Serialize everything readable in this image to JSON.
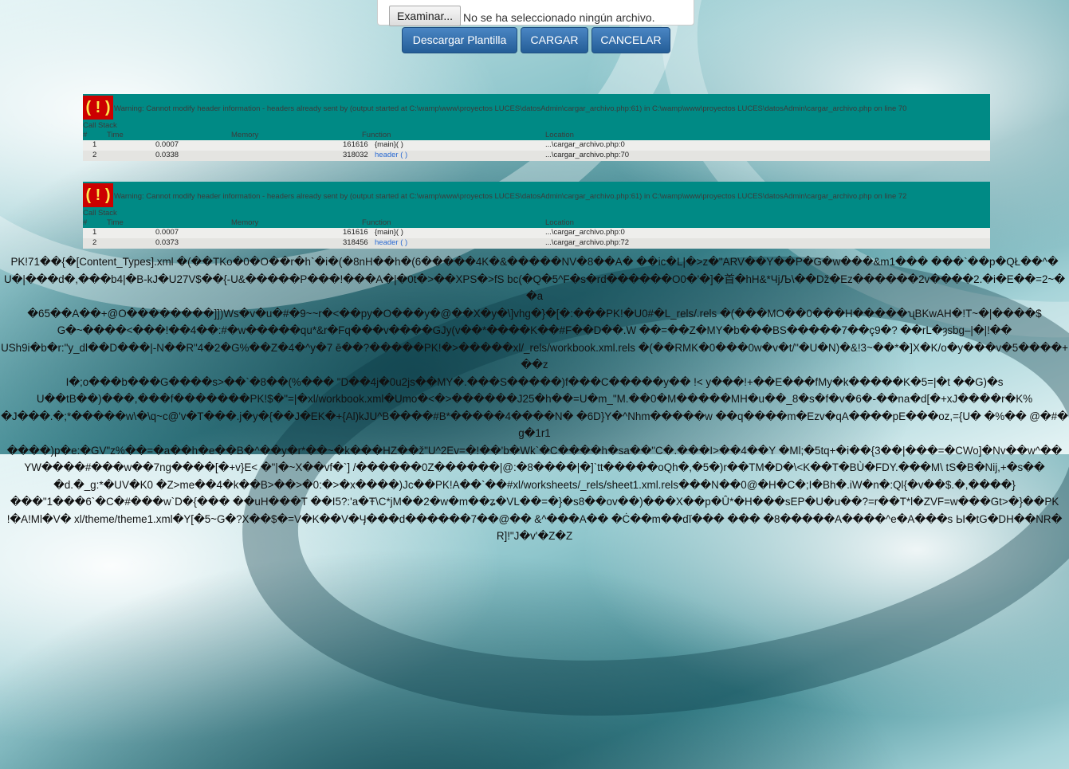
{
  "upload_form": {
    "browse_label": "Examinar...",
    "file_status": "No se ha seleccionado ningún archivo.",
    "download_template_label": "Descargar Plantilla",
    "upload_label": "CARGAR",
    "cancel_label": "CANCELAR",
    "button_color": "#2b6aa8"
  },
  "warnings": [
    {
      "icon_text": "( ! )",
      "message": "Warning: Cannot modify header information - headers already sent by (output started at C:\\wamp\\www\\proyectos LUCES\\datosAdmin\\cargar_archivo.php:61) in C:\\wamp\\www\\proyectos LUCES\\datosAdmin\\cargar_archivo.php on line 70",
      "stack_title": "Call Stack",
      "columns": [
        "#",
        "Time",
        "Memory",
        "Function",
        "Location"
      ],
      "rows": [
        {
          "n": "1",
          "time": "0.0007",
          "memory": "161616",
          "function": "{main}( )",
          "location": "...\\cargar_archivo.php:0",
          "link": false
        },
        {
          "n": "2",
          "time": "0.0338",
          "memory": "318032",
          "function": "header ( )",
          "location": "...\\cargar_archivo.php:70",
          "link": true
        }
      ]
    },
    {
      "icon_text": "( ! )",
      "message": "Warning: Cannot modify header information - headers already sent by (output started at C:\\wamp\\www\\proyectos LUCES\\datosAdmin\\cargar_archivo.php:61) in C:\\wamp\\www\\proyectos LUCES\\datosAdmin\\cargar_archivo.php on line 72",
      "stack_title": "Call Stack",
      "columns": [
        "#",
        "Time",
        "Memory",
        "Function",
        "Location"
      ],
      "rows": [
        {
          "n": "1",
          "time": "0.0007",
          "memory": "161616",
          "function": "{main}( )",
          "location": "...\\cargar_archivo.php:0",
          "link": false
        },
        {
          "n": "2",
          "time": "0.0373",
          "memory": "318456",
          "function": "header ( )",
          "location": "...\\cargar_archivo.php:72",
          "link": true
        }
      ]
    }
  ],
  "binary_dump": [
    "PK!71��{�[Content_Types].xml �(��TKo�0�O��r�h`�i�(�8nH��h�(6�����4K�&�����NV�8��A� ��ic�L|�>z�\"ARV��Y��P�G�w���&m1��� ���`��p�QŁ��^�",
    "U�|���d�,���b4|�B-kJ�U27V$��{-U&�����P���!���A�|�0t�>��XPS�>fS bc(�Q�5^F�s�rd������O0�'�]�首�hH&*ЧjЉ\\��Dž�Ez������2v����2.�i�E��=2~��a",
    "�65��A��+@O��������]])Ws�v�u�#�9~~r�<��py�O���y�@��X�y�\\]vhg�}�[�:���PK!�U0#�L_rels/.rels �(���MO��0���H�����ʯBKwAH�!T~�|����$",
    "G�~����<���!��4��:#�w�����qu*&r�Fq���v����GJy(v��*����K��#F��D��.W ��=��Z�MY�b���BS�����7��ç9�? ��rL�ȝsbg–|�|!��",
    "USh9i�b�r:\"y_dl��D���|-N��R\"4�2�G%��Z�4�^y�7 ē��?�����PK!�>�����xl/_rels/workbook.xml.rels �(��RMK�0���0w�v�t/\"�U�N)�&!3~��*�]X�K/o�y���v�5����+��z",
    "I�;o���b���G����s>��`�8��(%��� \"D��4j�0u2js��MY�.���S�����)f���C�����y�� !< y���!+��E���fMy�k�����K�5=|�t ��G)�s",
    "U��tB��)���,���f�������PK!$�\"=|�xl/workbook.xml�Umo�<�>������J25�h��=U�m_\"M.��0�M�����MH�u��_8�s�f�v�6�-��na�d[�+xJ����r�K%",
    "�J���.�;*�����w\\�\\q~c@'v�T���.j�y�{��J�EK�+{Al)kJU^B����#B*�����4����N� �6D}Y�^Nhm�����w ��q����m�Ezv�qA����pE���oz,={U� �%�� @�#�g�1r1",
    "����)p�e:�GV\"z%��=�a��h�e��B�^��y�r*��~�k���HZ��ž\"U^2Ev=�!��'b�Wk`�C����h�sa��\"C�.���I>��4��Y �Ml;�5tq+�i��{3��|���=�CWo]�Nv��w^��",
    "YW����#���w��7ng����[�+v}E< �\"|�~X��vf�`] /������0Z������|@:�8����|�]`tt�����oQh�,�5�)r��TM�D�\\<K��T�BÙ�FDY.���M\\ tS�B�Nij,+�s��",
    "�d.�_g:*�UV�K0 �Z>me��4�k��B>��>�0:�>�x����)Jc��PK!A��`��#xl/worksheets/_rels/sheet1.xml.rels���N��0@�H�C�;I�Bh�.iW�n�:Ql{�v��$.�,����}",
    "���\"1���6`�C�#���w`D�{��� ��uH���T ��I5?:'a�Ŧ\\C*jM��2�w�m��ʑ�VL��=�}�s8��ov��)���X��p�Û*�H���sEP�U�u��?=r��T*l�ZVF=w���Gt>�}��PK",
    "!�A!Ml�V�  xl/theme/theme1.xml�Y[�5~G�?X��$�=V�K��V�Ӌ���d������7��@�� &^���A�� �Ċ��m��dĭ��� ��� �8�����A����^e�A���s Ы�tG�DH��NR�R]!\"J�v'�Z�Z"
  ]
}
